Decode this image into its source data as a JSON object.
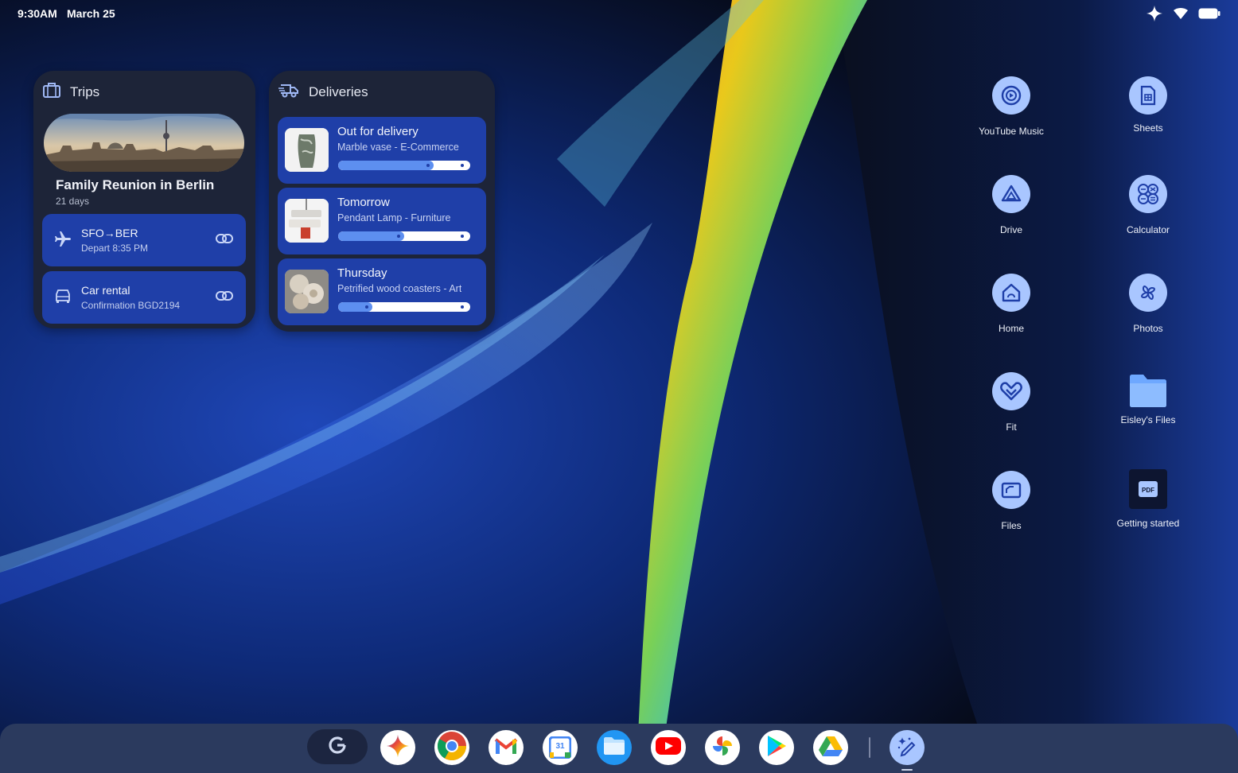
{
  "status_bar": {
    "time": "9:30AM",
    "date": "March 25",
    "icons": [
      "sparkle-icon",
      "wifi-icon",
      "battery-icon"
    ]
  },
  "trips_widget": {
    "title": "Trips",
    "trip_name": "Family Reunion in Berlin",
    "trip_days": "21 days",
    "cards": [
      {
        "icon": "airplane-icon",
        "line1": "SFO→BER",
        "line2": "Depart 8:35 PM",
        "action_icon": "link-icon"
      },
      {
        "icon": "car-icon",
        "line1": "Car rental",
        "line2": "Confirmation BGD2194",
        "action_icon": "link-icon"
      }
    ]
  },
  "deliveries_widget": {
    "title": "Deliveries",
    "items": [
      {
        "status": "Out for delivery",
        "item": "Marble vase - E-Commerce",
        "progress": 0.72
      },
      {
        "status": "Tomorrow",
        "item": "Pendant Lamp - Furniture",
        "progress": 0.5
      },
      {
        "status": "Thursday",
        "item": "Petrified wood coasters - Art",
        "progress": 0.26
      }
    ]
  },
  "apps": [
    {
      "label": "YouTube Music",
      "icon": "youtube-music-icon"
    },
    {
      "label": "Sheets",
      "icon": "sheets-icon"
    },
    {
      "label": "Drive",
      "icon": "drive-icon"
    },
    {
      "label": "Calculator",
      "icon": "calculator-icon"
    },
    {
      "label": "Home",
      "icon": "home-icon"
    },
    {
      "label": "Photos",
      "icon": "photos-icon"
    },
    {
      "label": "Fit",
      "icon": "fit-icon"
    },
    {
      "label": "Eisley's Files",
      "icon": "folder-icon"
    },
    {
      "label": "Files",
      "icon": "files-icon"
    },
    {
      "label": "Getting started",
      "icon": "pdf-icon"
    }
  ],
  "dock": {
    "items": [
      "google-search-icon",
      "gemini-icon",
      "chrome-icon",
      "gmail-icon",
      "calendar-icon",
      "files-icon",
      "youtube-icon",
      "photos-icon",
      "play-store-icon",
      "drive-icon",
      "ai-edit-icon"
    ],
    "calendar_day": "31"
  },
  "colors": {
    "widget_bg": "#1d2438",
    "card_bg": "#1f3fa8",
    "app_icon_bg": "#a9c6ff",
    "dock_bg": "#2b3a5e"
  }
}
